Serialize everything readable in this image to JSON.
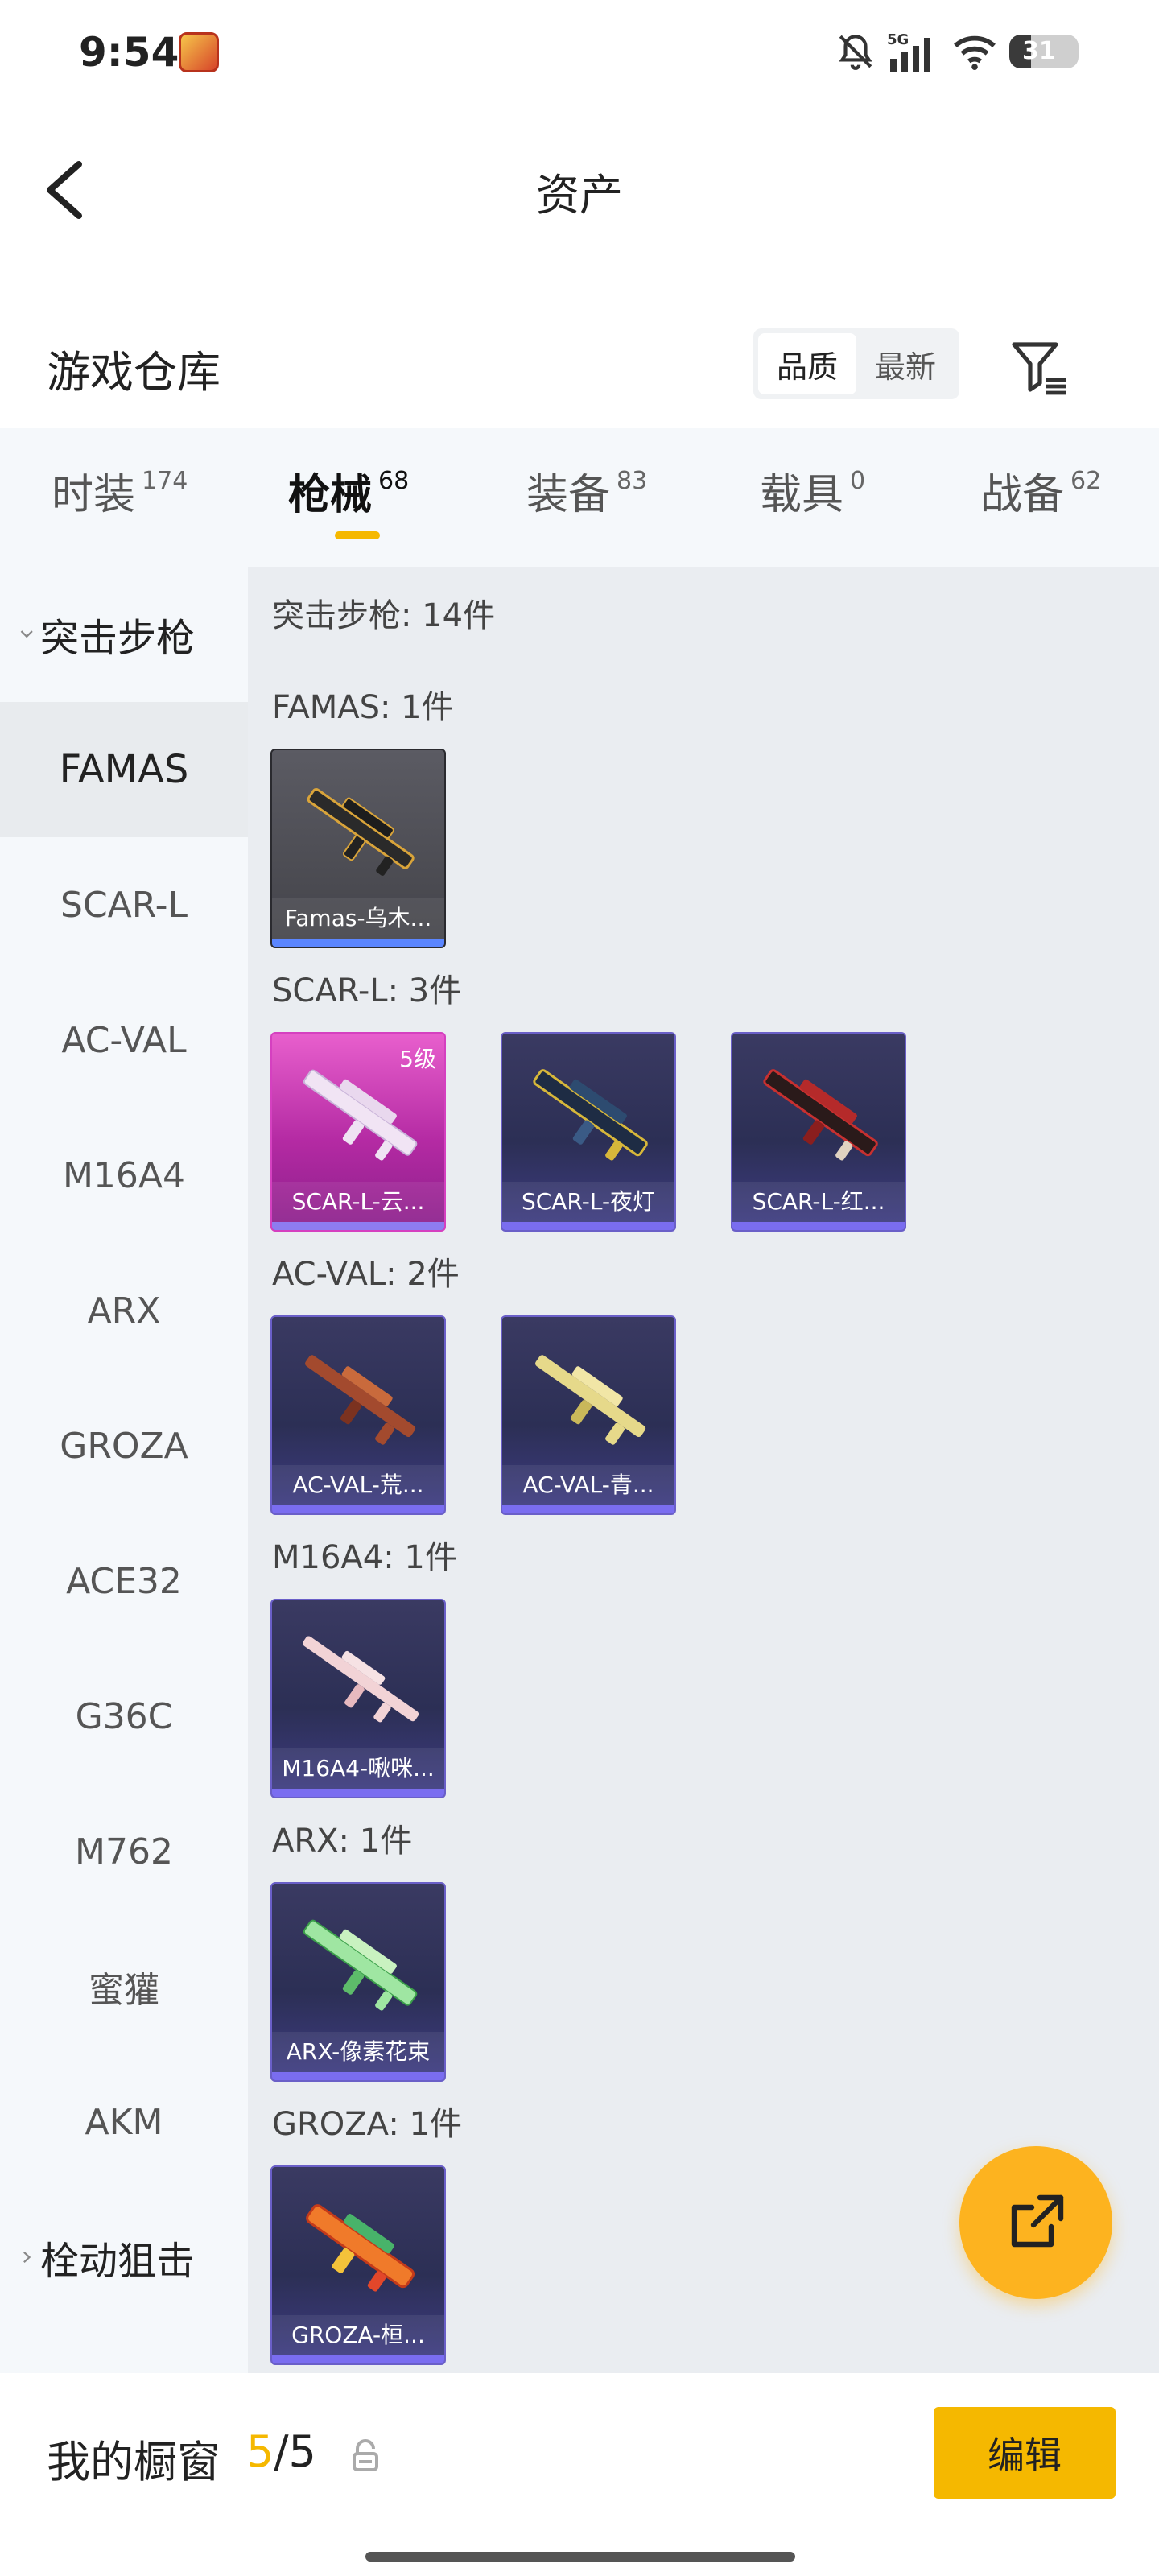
{
  "status_bar": {
    "time": "9:54",
    "battery": "31",
    "network": "5G",
    "app_badge_icon": "game-app-icon"
  },
  "header": {
    "title": "资产"
  },
  "warehouse": {
    "title": "游戏仓库",
    "sort_options": [
      "品质",
      "最新"
    ],
    "active_sort": "品质"
  },
  "tabs": [
    {
      "label": "时装",
      "count": "174"
    },
    {
      "label": "枪械",
      "count": "68",
      "active": true
    },
    {
      "label": "装备",
      "count": "83"
    },
    {
      "label": "载具",
      "count": "0"
    },
    {
      "label": "战备",
      "count": "62"
    }
  ],
  "sidebar": {
    "group1": "突击步枪",
    "items": [
      "FAMAS",
      "SCAR-L",
      "AC-VAL",
      "M16A4",
      "ARX",
      "GROZA",
      "ACE32",
      "G36C",
      "M762",
      "蜜獾",
      "AKM"
    ],
    "active_item": "FAMAS",
    "group2": "栓动狙击"
  },
  "content": {
    "summary": "突击步枪: 14件",
    "sections": [
      {
        "heading": "FAMAS: 1件",
        "cards": [
          {
            "name": "Famas-乌木...",
            "style": "grey"
          }
        ]
      },
      {
        "heading": "SCAR-L: 3件",
        "cards": [
          {
            "name": "SCAR-L-云...",
            "style": "pink",
            "level": "5级"
          },
          {
            "name": "SCAR-L-夜灯",
            "style": "purple"
          },
          {
            "name": "SCAR-L-红...",
            "style": "purple"
          }
        ]
      },
      {
        "heading": "AC-VAL: 2件",
        "cards": [
          {
            "name": "AC-VAL-荒...",
            "style": "purple"
          },
          {
            "name": "AC-VAL-青...",
            "style": "purple"
          }
        ]
      },
      {
        "heading": "M16A4: 1件",
        "cards": [
          {
            "name": "M16A4-啾咪...",
            "style": "purple"
          }
        ]
      },
      {
        "heading": "ARX: 1件",
        "cards": [
          {
            "name": "ARX-像素花束",
            "style": "purple"
          }
        ]
      },
      {
        "heading": "GROZA: 1件",
        "cards": [
          {
            "name": "GROZA-桓...",
            "style": "purple"
          }
        ]
      }
    ]
  },
  "bottom": {
    "label": "我的橱窗",
    "current": "5",
    "total": "/5",
    "edit": "编辑"
  },
  "colors": {
    "accent": "#f5b800",
    "fab": "#fdb31f",
    "card_purple": "#2c2f55",
    "card_pink": "#b42aa3"
  },
  "icons": {
    "back": "back-arrow-icon",
    "filter": "filter-icon",
    "share": "share-external-icon",
    "lock": "lock-icon"
  }
}
